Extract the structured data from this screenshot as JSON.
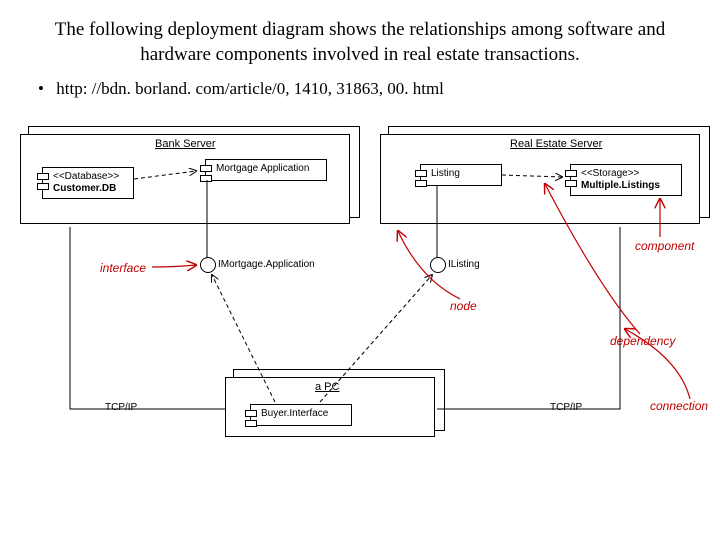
{
  "title": "The following deployment diagram shows the relationships among software and hardware components involved in real estate transactions.",
  "bullet": "http: //bdn. borland. com/article/0, 1410, 31863, 00. html",
  "nodes": {
    "bank_server": {
      "title": "Bank Server"
    },
    "real_estate_server": {
      "title": "Real Estate Server"
    },
    "pc": {
      "title": "a PC"
    }
  },
  "components": {
    "customer_db": {
      "stereotype": "<<Database>>",
      "name": "Customer.DB"
    },
    "mortgage_app": {
      "name": "Mortgage Application"
    },
    "listing": {
      "name": "Listing"
    },
    "multiple_listings": {
      "stereotype": "<<Storage>>",
      "name": "Multiple.Listings"
    },
    "buyer_interface": {
      "name": "Buyer.Interface"
    }
  },
  "interfaces": {
    "imortgage": "IMortgage.Application",
    "ilisting": "IListing"
  },
  "protocols": {
    "left": "TCP/IP",
    "right": "TCP/IP"
  },
  "annotations": {
    "interface": "interface",
    "node": "node",
    "component": "component",
    "dependency": "dependency",
    "connection": "connection"
  }
}
